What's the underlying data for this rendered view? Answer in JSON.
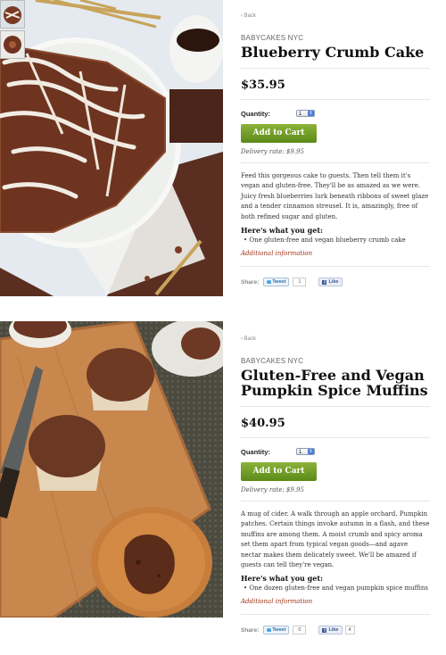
{
  "products": [
    {
      "back": "‹ Back",
      "brand": "BABYCAKES NYC",
      "title": "Blueberry Crumb Cake",
      "price": "$35.95",
      "quantity_label": "Quantity:",
      "quantity_value": "1",
      "add_to_cart": "Add to Cart",
      "delivery": "Delivery rate: $9.95",
      "description": "Feed this gorgeous cake to guests. Then tell them it's vegan and gluten-free. They'll be as amazed as we were. Juicy fresh blueberries lurk beneath ribbons of sweet glaze and a tender cinnamon streusel. It is, amazingly, free of both refined sugar and gluten.",
      "what_you_get_label": "Here's what you get:",
      "what_you_get": [
        "One gluten-free and vegan blueberry crumb cake"
      ],
      "additional_info": "Additional information",
      "share_label": "Share:",
      "tweet_label": "Tweet",
      "tweet_count": "1",
      "like_label": "Like",
      "like_count": ""
    },
    {
      "back": "‹ Back",
      "brand": "BABYCAKES NYC",
      "title": "Gluten-Free and Vegan Pumpkin Spice Muffins",
      "price": "$40.95",
      "quantity_label": "Quantity:",
      "quantity_value": "1",
      "add_to_cart": "Add to Cart",
      "delivery": "Delivery rate: $9.95",
      "description": "A mug of cider. A walk through an apple orchard. Pumpkin patches. Certain things invoke autumn in a flash, and these muffins are among them. A moist crumb and spicy aroma set them apart from typical vegan goods—and agave nectar makes them delicately sweet. We'll be amazed if guests can tell they're vegan.",
      "what_you_get_label": "Here's what you get:",
      "what_you_get": [
        "One dozen gluten-free and vegan pumpkin spice muffins"
      ],
      "additional_info": "Additional information",
      "share_label": "Share:",
      "tweet_label": "Tweet",
      "tweet_count": "0",
      "like_label": "Like",
      "like_count": "4"
    }
  ],
  "colors": {
    "add_to_cart": "#6f9b22",
    "link": "#a13218",
    "twitter": "#2d6ea6",
    "facebook": "#3b5998"
  }
}
